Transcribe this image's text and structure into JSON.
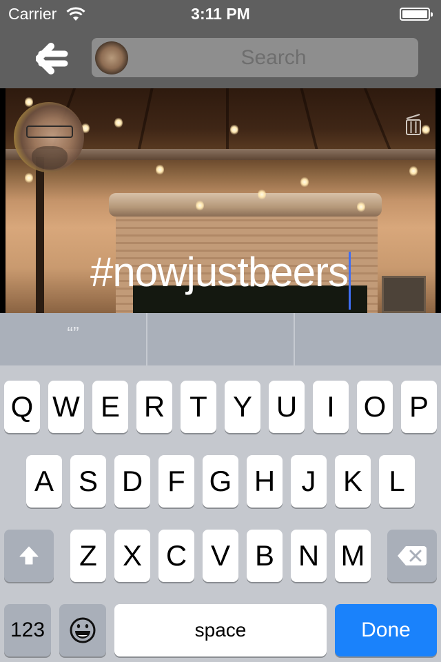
{
  "status_bar": {
    "carrier": "Carrier",
    "time": "3:11 PM",
    "wifi_icon": "wifi-icon",
    "battery_level": 1.0
  },
  "nav": {
    "back_icon": "back-arrow-icon",
    "search": {
      "placeholder": "Search",
      "value": ""
    }
  },
  "post": {
    "caption": "#nowjustbeers",
    "delete_icon": "trash-icon"
  },
  "keyboard": {
    "suggestions": [
      "“”",
      "",
      ""
    ],
    "row1": [
      "Q",
      "W",
      "E",
      "R",
      "T",
      "Y",
      "U",
      "I",
      "O",
      "P"
    ],
    "row2": [
      "A",
      "S",
      "D",
      "F",
      "G",
      "H",
      "J",
      "K",
      "L"
    ],
    "row3": [
      "Z",
      "X",
      "C",
      "V",
      "B",
      "N",
      "M"
    ],
    "shift_icon": "shift-icon",
    "delete_icon": "delete-icon",
    "numbers_label": "123",
    "emoji_icon": "emoji-icon",
    "space_label": "space",
    "done_label": "Done",
    "accent_color": "#1a82fb"
  }
}
